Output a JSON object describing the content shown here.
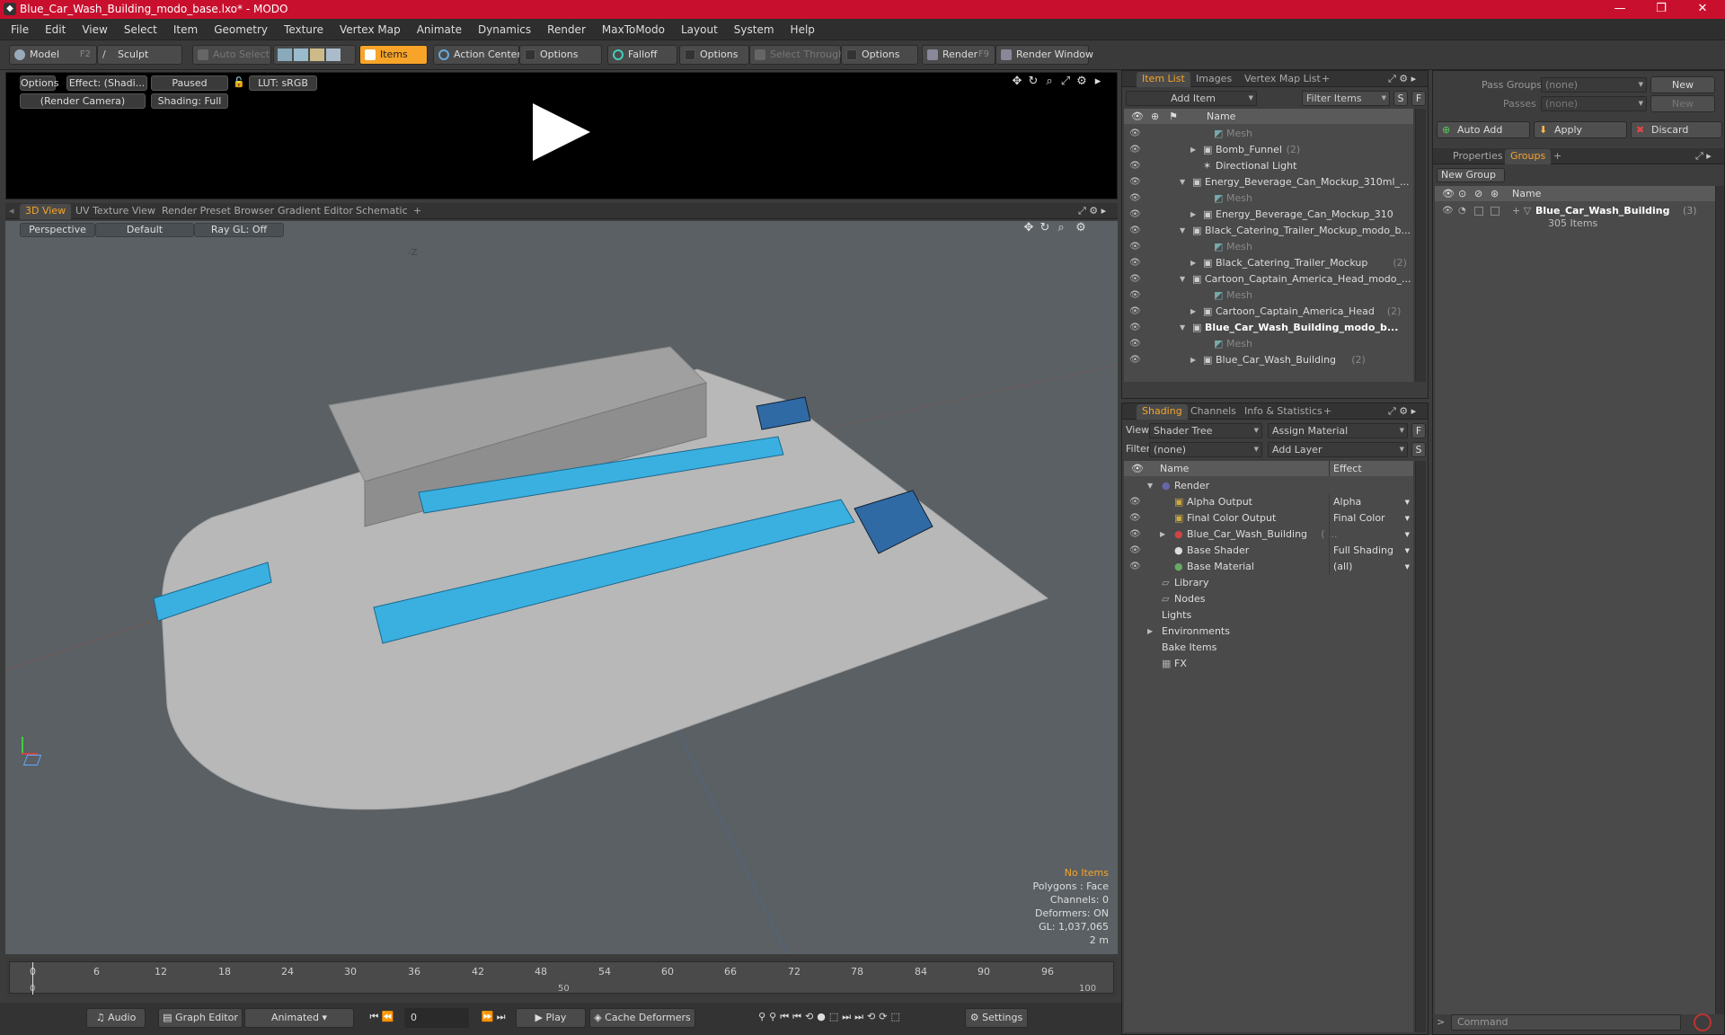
{
  "window": {
    "title": "Blue_Car_Wash_Building_modo_base.lxo* - MODO",
    "icon": "modo-app-icon",
    "min": "—",
    "max": "❐",
    "close": "✕"
  },
  "menu": [
    "File",
    "Edit",
    "View",
    "Select",
    "Item",
    "Geometry",
    "Texture",
    "Vertex Map",
    "Animate",
    "Dynamics",
    "Render",
    "MaxToModo",
    "Layout",
    "System",
    "Help"
  ],
  "toolbar": {
    "model": "Model",
    "model_key": "F2",
    "sculpt": "Sculpt",
    "auto_select": "Auto Select",
    "items": "Items",
    "action_center": "Action Center",
    "options1": "Options",
    "falloff": "Falloff",
    "options2": "Options",
    "select_through": "Select Through",
    "options3": "Options",
    "render": "Render",
    "render_key": "F9",
    "render_window": "Render Window"
  },
  "preview": {
    "options": "Options",
    "effect": "Effect: (Shadi...",
    "paused": "Paused",
    "lut": "LUT: sRGB",
    "camera": "(Render Camera)",
    "shading": "Shading: Full"
  },
  "view_tabs": [
    "3D View",
    "UV Texture View",
    "Render Preset Browser",
    "Gradient Editor",
    "Schematic",
    "+"
  ],
  "viewport": {
    "perspective": "Perspective",
    "default": "Default",
    "raygl": "Ray GL: Off",
    "axis_z": "-Z",
    "stats": {
      "no_items": "No Items",
      "polygons": "Polygons : Face",
      "channels": "Channels: 0",
      "deformers": "Deformers: ON",
      "gl": "GL: 1,037,065",
      "scale": "2 m"
    }
  },
  "timeline": {
    "ticks": [
      "0",
      "6",
      "12",
      "18",
      "24",
      "30",
      "36",
      "42",
      "48",
      "54",
      "60",
      "66",
      "72",
      "78",
      "84",
      "90",
      "96"
    ],
    "start": "0",
    "mid": "50",
    "end": "100"
  },
  "bottom": {
    "audio": "Audio",
    "graph_editor": "Graph Editor",
    "animated": "Animated",
    "frame": "0",
    "play": "Play",
    "cache": "Cache Deformers",
    "settings": "Settings"
  },
  "item_list": {
    "tabs": [
      "Item List",
      "Images",
      "Vertex Map List",
      "+"
    ],
    "add_item": "Add Item",
    "filter": "Filter Items",
    "s": "S",
    "f": "F",
    "name_col": "Name",
    "rows": [
      {
        "t": "Mesh",
        "dim": true,
        "ind": 3
      },
      {
        "t": "Bomb_Funnel",
        "c": "(2)",
        "ind": 2,
        "arrow": "▶"
      },
      {
        "t": "Directional Light",
        "ind": 2
      },
      {
        "t": "Energy_Beverage_Can_Mockup_310ml_...",
        "ind": 1,
        "arrow": "▼"
      },
      {
        "t": "Mesh",
        "dim": true,
        "ind": 3
      },
      {
        "t": "Energy_Beverage_Can_Mockup_310",
        "ind": 2,
        "arrow": "▶"
      },
      {
        "t": "Black_Catering_Trailer_Mockup_modo_b...",
        "ind": 1,
        "arrow": "▼"
      },
      {
        "t": "Mesh",
        "dim": true,
        "ind": 3
      },
      {
        "t": "Black_Catering_Trailer_Mockup",
        "c": "(2)",
        "ind": 2,
        "arrow": "▶"
      },
      {
        "t": "Cartoon_Captain_America_Head_modo_...",
        "ind": 1,
        "arrow": "▼"
      },
      {
        "t": "Mesh",
        "dim": true,
        "ind": 3
      },
      {
        "t": "Cartoon_Captain_America_Head",
        "c": "(2)",
        "ind": 2,
        "arrow": "▶"
      },
      {
        "t": "Blue_Car_Wash_Building_modo_b...",
        "ind": 1,
        "arrow": "▼",
        "bold": true
      },
      {
        "t": "Mesh",
        "dim": true,
        "ind": 3
      },
      {
        "t": "Blue_Car_Wash_Building",
        "c": "(2)",
        "ind": 2,
        "arrow": "▶"
      }
    ]
  },
  "shading": {
    "tabs": [
      "Shading",
      "Channels",
      "Info & Statistics",
      "+"
    ],
    "view_label": "View",
    "view_val": "Shader Tree",
    "assign": "Assign Material",
    "filter_label": "Filter",
    "filter_val": "(none)",
    "add_layer": "Add Layer",
    "f": "F",
    "s": "S",
    "name_col": "Name",
    "effect_col": "Effect",
    "rows": [
      {
        "t": "Render",
        "e": "",
        "ind": 0,
        "arrow": "▼",
        "eye": false
      },
      {
        "t": "Alpha Output",
        "e": "Alpha",
        "ind": 1,
        "eye": true
      },
      {
        "t": "Final Color Output",
        "e": "Final Color",
        "ind": 1,
        "eye": true
      },
      {
        "t": "Blue_Car_Wash_Building",
        "c": "( ...",
        "e": "",
        "ind": 1,
        "arrow": "▶",
        "eye": true
      },
      {
        "t": "Base Shader",
        "e": "Full Shading",
        "ind": 1,
        "eye": true
      },
      {
        "t": "Base Material",
        "e": "(all)",
        "ind": 1,
        "eye": true
      },
      {
        "t": "Library",
        "ind": 0,
        "eye": false
      },
      {
        "t": "Nodes",
        "ind": 0,
        "eye": false
      },
      {
        "t": "Lights",
        "ind": 0,
        "eye": false
      },
      {
        "t": "Environments",
        "ind": 0,
        "arrow": "▶",
        "eye": false
      },
      {
        "t": "Bake Items",
        "ind": 0,
        "eye": false
      },
      {
        "t": "FX",
        "ind": 0,
        "eye": false
      }
    ]
  },
  "groups": {
    "pass_groups": "Pass Groups",
    "passes": "Passes",
    "none": "(none)",
    "new": "New",
    "auto_add": "Auto Add",
    "apply": "Apply",
    "discard": "Discard",
    "tabs": [
      "Properties",
      "Groups",
      "+"
    ],
    "new_group": "New Group",
    "name_col": "Name",
    "group_name": "Blue_Car_Wash_Building",
    "group_count": "(3)",
    "group_items": "305 Items"
  },
  "command": {
    "placeholder": "Command"
  }
}
